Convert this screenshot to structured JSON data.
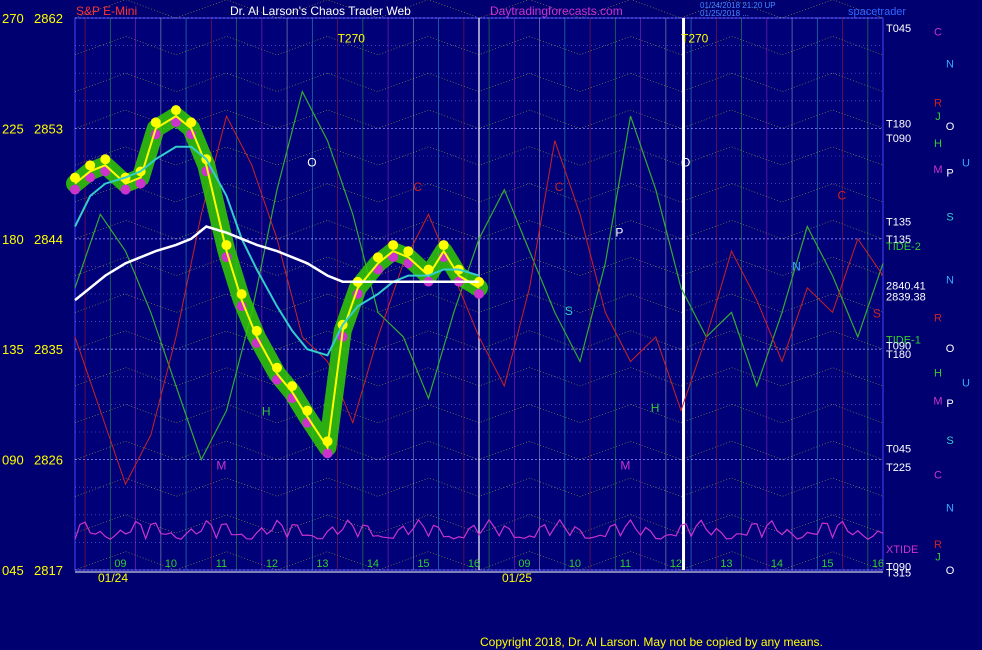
{
  "header": {
    "symbol": "S&P E-Mini",
    "title": "Dr. Al Larson's Chaos Trader Web",
    "site": "Daytradingforecasts.com",
    "timestamp1": "01/24/2018 21:20 UP",
    "timestamp2": "01/25/2018 ...",
    "brand": "spacetrader"
  },
  "footer": {
    "copyright": "Copyright 2018, Dr. Al Larson. May not be copied by any means."
  },
  "colors": {
    "background": "#000070",
    "grid": "#3333cc",
    "price_green": "#33cc00",
    "price_yellow": "#ffff00",
    "price_magenta": "#cc33cc",
    "ma_fast": "#33cccc",
    "ma_slow": "#ffffff",
    "tide": "#33aa33",
    "xtide": "#cc33cc",
    "red_line": "#cc2222"
  },
  "chart_data": {
    "type": "line",
    "ylabel_left_angle": [
      "270",
      "225",
      "180",
      "135",
      "090",
      "045"
    ],
    "ylabel_left_price": [
      "2862",
      "2853",
      "2844",
      "2835",
      "2826",
      "2817"
    ],
    "ylim": [
      2817,
      2862
    ],
    "x_ticks": [
      "09",
      "10",
      "11",
      "12",
      "13",
      "14",
      "15",
      "16",
      "09",
      "10",
      "11",
      "12",
      "13",
      "14",
      "15",
      "16"
    ],
    "x_dates": [
      "01/24",
      "01/25"
    ],
    "x": [
      8.0,
      8.3,
      8.6,
      9.0,
      9.3,
      9.6,
      10.0,
      10.3,
      10.6,
      11.0,
      11.3,
      11.6,
      12.0,
      12.3,
      12.6,
      13.0,
      13.3,
      13.6,
      14.0,
      14.3,
      14.6,
      15.0,
      15.3,
      15.6,
      16.0
    ],
    "series": [
      {
        "values": [
          2848.5,
          2849.5,
          2850.0,
          2848.5,
          2849.0,
          2853.0,
          2854.0,
          2853.0,
          2850.0,
          2843.0,
          2839.0,
          2836.0,
          2833.0,
          2831.5,
          2829.5,
          2827.0,
          2836.5,
          2840.0,
          2842.0,
          2843.0,
          2842.5,
          2841.0,
          2843.0,
          2841.0,
          2840.0
        ]
      },
      {
        "values": [
          2845.0,
          2847.5,
          2848.5,
          2849.0,
          2849.5,
          2850.5,
          2851.5,
          2851.5,
          2850.5,
          2847.5,
          2844.0,
          2841.5,
          2838.5,
          2836.5,
          2835.0,
          2834.5,
          2837.0,
          2838.5,
          2839.5,
          2840.5,
          2841.0,
          2841.0,
          2841.5,
          2841.5,
          2841.0
        ]
      },
      {
        "values": [
          2839.0,
          2840.0,
          2841.0,
          2842.0,
          2842.5,
          2843.0,
          2843.5,
          2844.0,
          2845.0,
          2844.5,
          2844.0,
          2843.5,
          2843.0,
          2842.5,
          2842.0,
          2841.0,
          2840.5,
          2840.5,
          2840.5,
          2840.5,
          2840.5,
          2840.5,
          2840.5,
          2840.5,
          2840.5
        ]
      }
    ],
    "tide_forecast": {
      "x": [
        8.0,
        8.5,
        9.0,
        9.5,
        10.0,
        10.5,
        11.0,
        11.5,
        12.0,
        12.5,
        13.0,
        13.5,
        14.0,
        14.5,
        15.0,
        15.5,
        16.0,
        16.5,
        17.0,
        17.5,
        18.0,
        18.5,
        19.0,
        19.5,
        20.0,
        20.5,
        21.0,
        21.5,
        22.0,
        22.5,
        23.0,
        23.5,
        24.0
      ],
      "values": [
        2840,
        2846,
        2843,
        2838,
        2832,
        2826,
        2830,
        2838,
        2848,
        2856,
        2852,
        2846,
        2838,
        2836,
        2831,
        2838,
        2844,
        2848,
        2843,
        2838,
        2834,
        2842,
        2854,
        2848,
        2840,
        2836,
        2838,
        2832,
        2838,
        2845,
        2841,
        2836,
        2842
      ]
    },
    "right_labels": [
      {
        "text": "T045",
        "price": 2861.2
      },
      {
        "text": "T180",
        "price": 2853.4
      },
      {
        "text": "T090",
        "price": 2852.2
      },
      {
        "text": "T135",
        "price": 2845.4
      },
      {
        "text": "T135",
        "price": 2844.0
      },
      {
        "text": "TIDE-2",
        "price": 2843.4
      },
      {
        "text": "2840.41",
        "price": 2840.2
      },
      {
        "text": "2839.38",
        "price": 2839.3
      },
      {
        "text": "TIDE-1",
        "price": 2835.8
      },
      {
        "text": "T090",
        "price": 2835.3
      },
      {
        "text": "T180",
        "price": 2834.6
      },
      {
        "text": "T045",
        "price": 2826.9
      },
      {
        "text": "T225",
        "price": 2825.4
      },
      {
        "text": "XTIDE",
        "price": 2818.7
      },
      {
        "text": "T090",
        "price": 2817.3
      },
      {
        "text": "T315",
        "price": 2816.8
      }
    ],
    "planet_glyphs": [
      {
        "text": "C",
        "price": 2860.9,
        "col": 0,
        "color": "#cc33cc"
      },
      {
        "text": "N",
        "price": 2858.3,
        "col": 1,
        "color": "#33aaff"
      },
      {
        "text": "R",
        "price": 2855.1,
        "col": 0,
        "color": "#cc2222"
      },
      {
        "text": "J",
        "price": 2854.0,
        "col": 0,
        "color": "#33cc33"
      },
      {
        "text": "O",
        "price": 2853.2,
        "col": 1,
        "color": "#ffffff"
      },
      {
        "text": "H",
        "price": 2851.8,
        "col": 0,
        "color": "#33cc33"
      },
      {
        "text": "U",
        "price": 2850.2,
        "col": 2,
        "color": "#33aaff"
      },
      {
        "text": "M",
        "price": 2849.7,
        "col": 0,
        "color": "#cc33cc"
      },
      {
        "text": "P",
        "price": 2849.4,
        "col": 1,
        "color": "#ffffff"
      },
      {
        "text": "S",
        "price": 2845.8,
        "col": 1,
        "color": "#33cccc"
      },
      {
        "text": "N",
        "price": 2840.7,
        "col": 1,
        "color": "#33aaff"
      },
      {
        "text": "R",
        "price": 2837.6,
        "col": 0,
        "color": "#cc2222"
      },
      {
        "text": "O",
        "price": 2835.1,
        "col": 1,
        "color": "#ffffff"
      },
      {
        "text": "H",
        "price": 2833.1,
        "col": 0,
        "color": "#33cc33"
      },
      {
        "text": "U",
        "price": 2832.3,
        "col": 2,
        "color": "#33aaff"
      },
      {
        "text": "M",
        "price": 2830.8,
        "col": 0,
        "color": "#cc33cc"
      },
      {
        "text": "P",
        "price": 2830.6,
        "col": 1,
        "color": "#ffffff"
      },
      {
        "text": "S",
        "price": 2827.6,
        "col": 1,
        "color": "#33cccc"
      },
      {
        "text": "C",
        "price": 2824.8,
        "col": 0,
        "color": "#cc33cc"
      },
      {
        "text": "N",
        "price": 2822.1,
        "col": 1,
        "color": "#33aaff"
      },
      {
        "text": "R",
        "price": 2819.1,
        "col": 0,
        "color": "#cc2222"
      },
      {
        "text": "J",
        "price": 2818.1,
        "col": 0,
        "color": "#33cc33"
      },
      {
        "text": "O",
        "price": 2817.0,
        "col": 1,
        "color": "#ffffff"
      }
    ],
    "annotations": [
      {
        "text": "T270",
        "x": 13.2,
        "price": 2860.0,
        "color": "#ffff00"
      },
      {
        "text": "T270",
        "x": 20.0,
        "price": 2860.0,
        "color": "#ffff00"
      },
      {
        "text": "O",
        "x": 12.6,
        "price": 2849.9,
        "color": "#ffffff"
      },
      {
        "text": "O",
        "x": 20.0,
        "price": 2849.9,
        "color": "#ffffff"
      },
      {
        "text": "C",
        "x": 14.7,
        "price": 2847.9,
        "color": "#cc2222"
      },
      {
        "text": "C",
        "x": 17.5,
        "price": 2847.9,
        "color": "#cc2222"
      },
      {
        "text": "P",
        "x": 18.7,
        "price": 2844.2,
        "color": "#ffffff"
      },
      {
        "text": "S",
        "x": 17.7,
        "price": 2837.8,
        "color": "#33cccc"
      },
      {
        "text": "H",
        "x": 11.7,
        "price": 2829.6,
        "color": "#33cc33"
      },
      {
        "text": "M",
        "x": 10.8,
        "price": 2825.2,
        "color": "#cc33cc"
      },
      {
        "text": "M",
        "x": 18.8,
        "price": 2825.2,
        "color": "#cc33cc"
      },
      {
        "text": "N",
        "x": 22.2,
        "price": 2841.4,
        "color": "#33aaff"
      },
      {
        "text": "H",
        "x": 19.4,
        "price": 2829.9,
        "color": "#33cc33"
      },
      {
        "text": "C",
        "x": 23.1,
        "price": 2847.2,
        "color": "#cc2222"
      },
      {
        "text": "S",
        "x": 23.8,
        "price": 2837.6,
        "color": "#cc2222"
      }
    ]
  }
}
